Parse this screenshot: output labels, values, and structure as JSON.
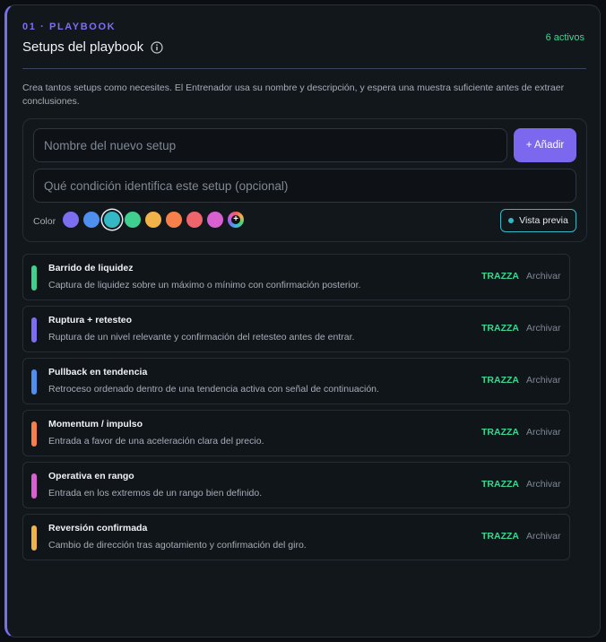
{
  "header": {
    "eyebrow": "01 · PLAYBOOK",
    "title": "Setups del playbook",
    "count": "6 activos",
    "description": "Crea tantos setups como necesites. El Entrenador usa su nombre y descripción, y espera una muestra suficiente antes de extraer conclusiones."
  },
  "form": {
    "name_placeholder": "Nombre del nuevo setup",
    "condition_placeholder": "Qué condición identifica este setup (opcional)",
    "add_label": "+ Añadir",
    "color_label": "Color",
    "preview_label": "Vista previa",
    "colors": [
      "#7b6ef0",
      "#4f8ff0",
      "#35b8c6",
      "#3fcf8e",
      "#f0b34a",
      "#f5804a",
      "#f0646c",
      "#d860d0"
    ],
    "selected_color": "#35b8c6",
    "custom_color_icon": "plus-icon"
  },
  "setups": [
    {
      "name": "Barrido de liquidez",
      "description": "Captura de liquidez sobre un máximo o mínimo con confirmación posterior.",
      "color": "#3fcf8e",
      "action": "TRAZZA",
      "archive": "Archivar"
    },
    {
      "name": "Ruptura + retesteo",
      "description": "Ruptura de un nivel relevante y confirmación del retesteo antes de entrar.",
      "color": "#7b6ef0",
      "action": "TRAZZA",
      "archive": "Archivar"
    },
    {
      "name": "Pullback en tendencia",
      "description": "Retroceso ordenado dentro de una tendencia activa con señal de continuación.",
      "color": "#4f8ff0",
      "action": "TRAZZA",
      "archive": "Archivar"
    },
    {
      "name": "Momentum / impulso",
      "description": "Entrada a favor de una aceleración clara del precio.",
      "color": "#f5804a",
      "action": "TRAZZA",
      "archive": "Archivar"
    },
    {
      "name": "Operativa en rango",
      "description": "Entrada en los extremos de un rango bien definido.",
      "color": "#d860d0",
      "action": "TRAZZA",
      "archive": "Archivar"
    },
    {
      "name": "Reversión confirmada",
      "description": "Cambio de dirección tras agotamiento y confirmación del giro.",
      "color": "#f0b34a",
      "action": "TRAZZA",
      "archive": "Archivar"
    }
  ]
}
